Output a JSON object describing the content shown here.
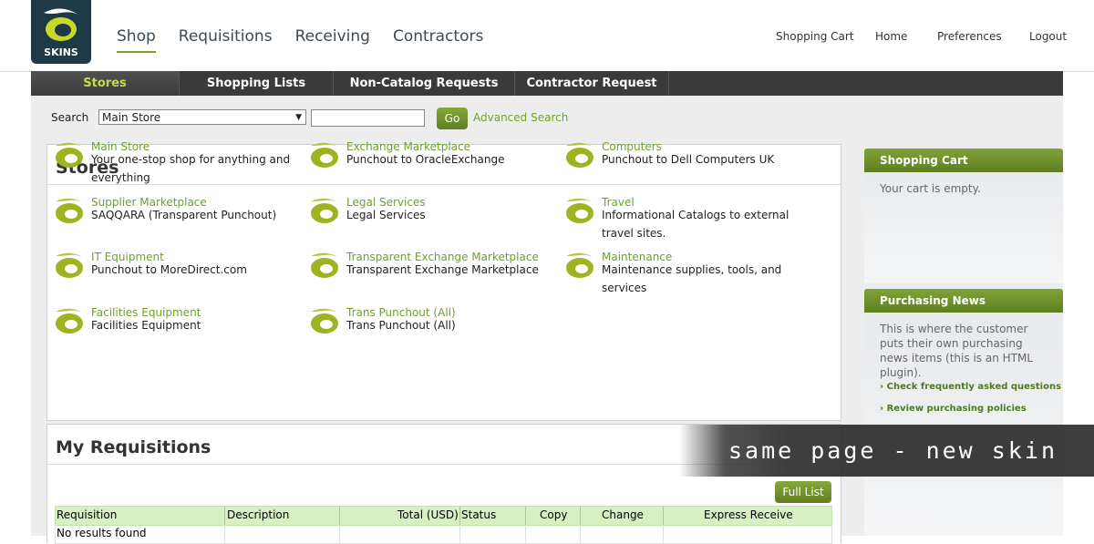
{
  "header": {
    "logo_text": "SKINS",
    "main_nav": [
      "Shop",
      "Requisitions",
      "Receiving",
      "Contractors"
    ],
    "util_nav": [
      "Shopping Cart",
      "Home",
      "Preferences",
      "Logout"
    ]
  },
  "tabs": [
    "Stores",
    "Shopping Lists",
    "Non-Catalog Requests",
    "Contractor Request"
  ],
  "search": {
    "label": "Search",
    "selected_store": "Main Store",
    "go_label": "Go",
    "advanced_label": "Advanced Search"
  },
  "stores": {
    "title": "Stores",
    "items": [
      {
        "name": "Main Store",
        "desc": "Your one-stop shop for anything and everything"
      },
      {
        "name": "Exchange Marketplace",
        "desc": "Punchout to OracleExchange"
      },
      {
        "name": "Computers",
        "desc": "Punchout to Dell Computers UK"
      },
      {
        "name": "Supplier Marketplace",
        "desc": "SAQQARA (Transparent Punchout)"
      },
      {
        "name": "Legal Services",
        "desc": "Legal Services"
      },
      {
        "name": "Travel",
        "desc": "Informational Catalogs to external travel sites."
      },
      {
        "name": "IT Equipment",
        "desc": "Punchout to MoreDirect.com"
      },
      {
        "name": "Transparent Exchange Marketplace",
        "desc": "Transparent Exchange Marketplace"
      },
      {
        "name": "Maintenance",
        "desc": "Maintenance supplies, tools, and services"
      },
      {
        "name": "Facilities Equipment",
        "desc": "Facilities Equipment"
      },
      {
        "name": "Trans Punchout (All)",
        "desc": "Trans Punchout (All)"
      }
    ]
  },
  "requisitions": {
    "title": "My Requisitions",
    "full_list_label": "Full List",
    "columns": [
      "Requisition",
      "Description",
      "Total (USD)",
      "Status",
      "Copy",
      "Change",
      "Express Receive"
    ],
    "empty_text": "No results found"
  },
  "cart": {
    "title": "Shopping Cart",
    "empty_text": "Your cart is empty."
  },
  "news": {
    "title": "Purchasing News",
    "body": "This is where the customer puts their own purchasing news items (this is an HTML plugin).",
    "links": [
      "Check frequently asked questions",
      "Review purchasing policies"
    ]
  },
  "overlay": {
    "text": "same page - new skin"
  },
  "colors": {
    "accent": "#7aa22b",
    "link": "#6ea02c",
    "tabbar": "#3a3a3a",
    "active_tab_text": "#c2dc4f"
  }
}
